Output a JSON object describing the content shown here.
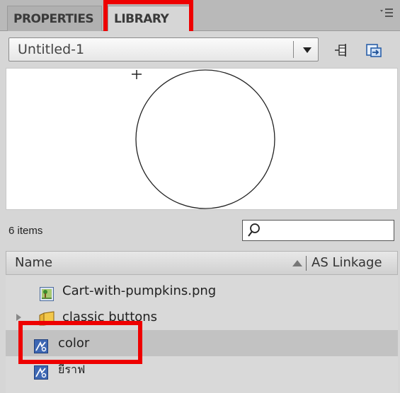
{
  "tabs": [
    {
      "label": "PROPERTIES",
      "active": false
    },
    {
      "label": "LIBRARY",
      "active": true
    }
  ],
  "panel_menu_icon": "panel-menu-icon",
  "document_select": {
    "value": "Untitled-1"
  },
  "toolbar_icons": [
    "pin-library-icon",
    "new-library-panel-icon"
  ],
  "preview": {
    "shape": "circle-outline"
  },
  "item_count": "6 items",
  "search": {
    "value": "",
    "icon": "search-icon"
  },
  "columns": {
    "name": "Name",
    "linkage": "AS Linkage"
  },
  "items": [
    {
      "label": "Cart-with-pumpkins.png",
      "icon": "bitmap-icon",
      "selected": false
    },
    {
      "label": "classic buttons",
      "icon": "folder-icon",
      "selected": false
    },
    {
      "label": "color",
      "icon": "graphic-symbol-icon",
      "selected": true
    },
    {
      "label": "ยีราฟ",
      "icon": "graphic-symbol-icon",
      "selected": false
    }
  ],
  "colors": {
    "highlight": "#ee0000",
    "selected_row": "#c2c2c2"
  }
}
